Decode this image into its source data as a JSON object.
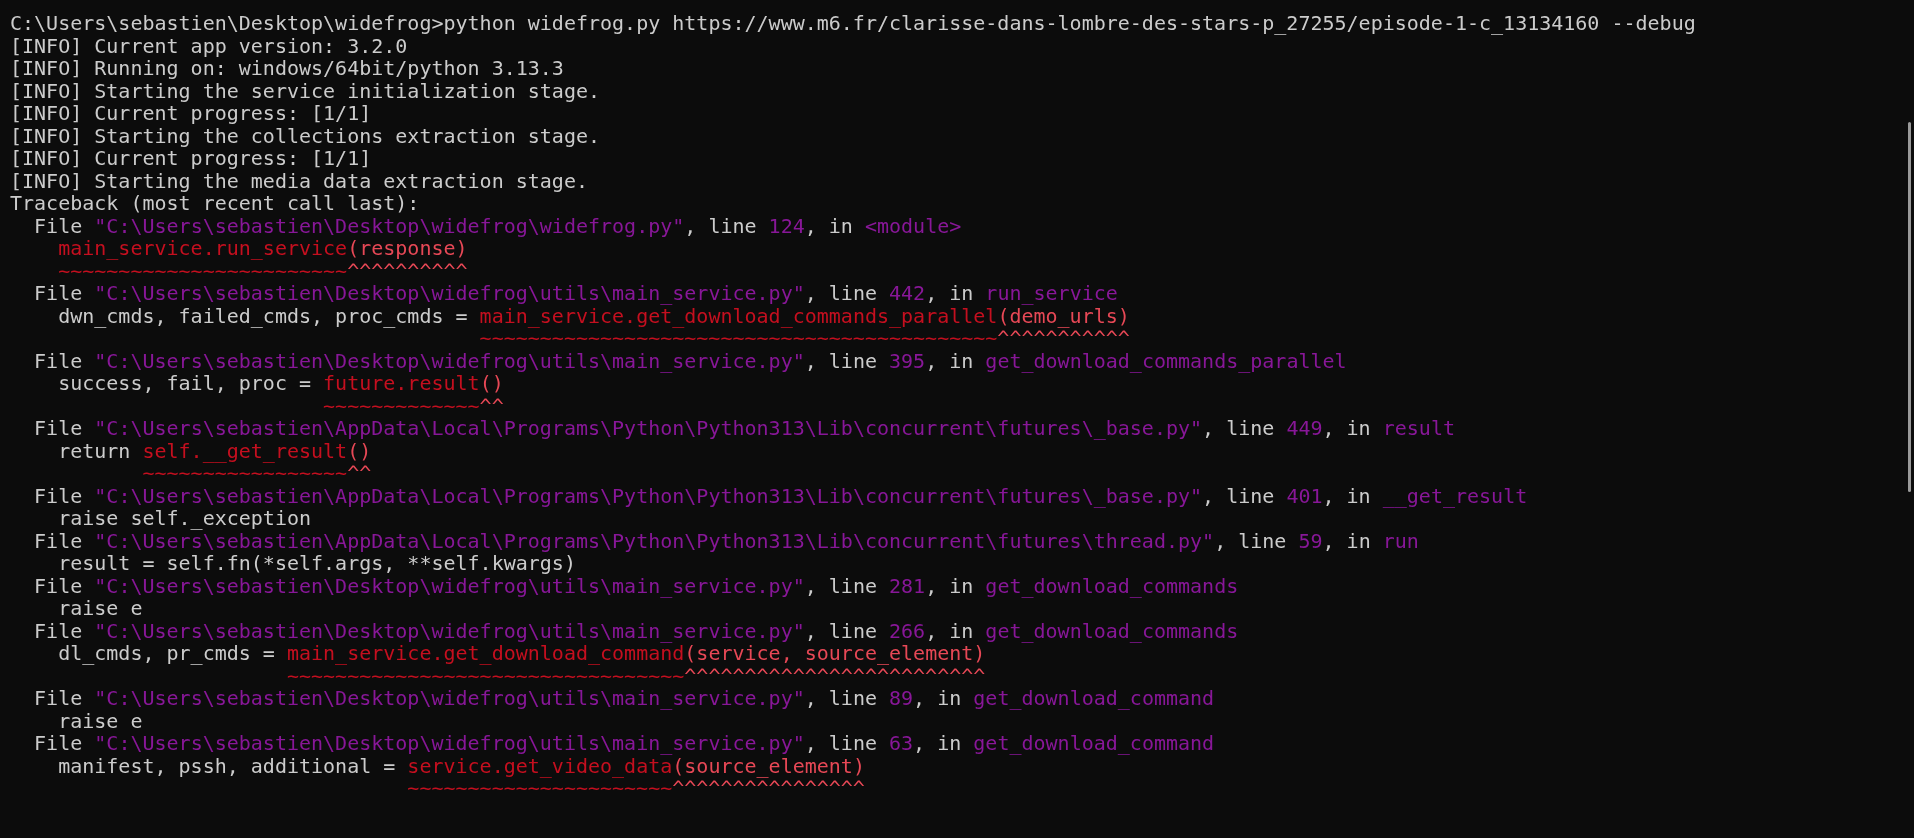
{
  "terminal": {
    "lines": [
      {
        "segments": [
          {
            "kind": "plain",
            "text": "C:\\Users\\sebastien\\Desktop\\widefrog>python widefrog.py https://www.m6.fr/clarisse-dans-lombre-des-stars-p_27255/episode-1-c_13134160 --debug"
          }
        ]
      },
      {
        "segments": [
          {
            "kind": "plain",
            "text": "[INFO] Current app version: 3.2.0"
          }
        ]
      },
      {
        "segments": [
          {
            "kind": "plain",
            "text": "[INFO] Running on: windows/64bit/python 3.13.3"
          }
        ]
      },
      {
        "segments": [
          {
            "kind": "plain",
            "text": "[INFO] Starting the service initialization stage."
          }
        ]
      },
      {
        "segments": [
          {
            "kind": "plain",
            "text": "[INFO] Current progress: [1/1]"
          }
        ]
      },
      {
        "segments": [
          {
            "kind": "plain",
            "text": "[INFO] Starting the collections extraction stage."
          }
        ]
      },
      {
        "segments": [
          {
            "kind": "plain",
            "text": "[INFO] Current progress: [1/1]"
          }
        ]
      },
      {
        "segments": [
          {
            "kind": "plain",
            "text": "[INFO] Starting the media data extraction stage."
          }
        ]
      },
      {
        "segments": [
          {
            "kind": "plain",
            "text": "Traceback (most recent call last):"
          }
        ]
      },
      {
        "segments": [
          {
            "kind": "plain",
            "text": "  File "
          },
          {
            "kind": "path",
            "text": "\"C:\\Users\\sebastien\\Desktop\\widefrog\\widefrog.py\""
          },
          {
            "kind": "plain",
            "text": ", line "
          },
          {
            "kind": "number",
            "text": "124"
          },
          {
            "kind": "plain",
            "text": ", in "
          },
          {
            "kind": "function",
            "text": "<module>"
          }
        ]
      },
      {
        "segments": [
          {
            "kind": "call",
            "text": "main_service.run_service"
          },
          {
            "kind": "args",
            "text": "(response)"
          }
        ]
      },
      {
        "segments": [
          {
            "kind": "tilde",
            "text": "~~~~~~~~~~~~~~~~~~~~~~~~"
          },
          {
            "kind": "caret",
            "text": "^^^^^^^^^^"
          }
        ]
      },
      {
        "segments": [
          {
            "kind": "plain",
            "text": "  File "
          },
          {
            "kind": "path",
            "text": "\"C:\\Users\\sebastien\\Desktop\\widefrog\\utils\\main_service.py\""
          },
          {
            "kind": "plain",
            "text": ", line "
          },
          {
            "kind": "number",
            "text": "442"
          },
          {
            "kind": "plain",
            "text": ", in "
          },
          {
            "kind": "function",
            "text": "run_service"
          }
        ]
      },
      {
        "segments": [
          {
            "kind": "plain",
            "text": "    dwn_cmds, failed_cmds, proc_cmds = "
          },
          {
            "kind": "call",
            "text": "main_service.get_download_commands_parallel"
          },
          {
            "kind": "args",
            "text": "(demo_urls)"
          }
        ]
      },
      {
        "segments": [
          {
            "kind": "tilde",
            "text": "~~~~~~~~~~~~~~~~~~~~~~~~~~~~~~~~~~~~~~~~~~~"
          },
          {
            "kind": "caret",
            "text": "^^^^^^^^^^^"
          }
        ]
      },
      {
        "segments": [
          {
            "kind": "plain",
            "text": "  File "
          },
          {
            "kind": "path",
            "text": "\"C:\\Users\\sebastien\\Desktop\\widefrog\\utils\\main_service.py\""
          },
          {
            "kind": "plain",
            "text": ", line "
          },
          {
            "kind": "number",
            "text": "395"
          },
          {
            "kind": "plain",
            "text": ", in "
          },
          {
            "kind": "function",
            "text": "get_download_commands_parallel"
          }
        ]
      },
      {
        "segments": [
          {
            "kind": "plain",
            "text": "    success, fail, proc = "
          },
          {
            "kind": "call",
            "text": "future.result"
          },
          {
            "kind": "args",
            "text": "()"
          }
        ]
      },
      {
        "segments": [
          {
            "kind": "tilde",
            "text": "~~~~~~~~~~~~~"
          },
          {
            "kind": "caret",
            "text": "^^"
          }
        ]
      },
      {
        "segments": [
          {
            "kind": "plain",
            "text": "  File "
          },
          {
            "kind": "path",
            "text": "\"C:\\Users\\sebastien\\AppData\\Local\\Programs\\Python\\Python313\\Lib\\concurrent\\futures\\_base.py\""
          },
          {
            "kind": "plain",
            "text": ", line "
          },
          {
            "kind": "number",
            "text": "449"
          },
          {
            "kind": "plain",
            "text": ", in "
          },
          {
            "kind": "function",
            "text": "result"
          }
        ]
      },
      {
        "segments": [
          {
            "kind": "plain",
            "text": "    return "
          },
          {
            "kind": "call",
            "text": "self.__get_result"
          },
          {
            "kind": "args",
            "text": "()"
          }
        ]
      },
      {
        "segments": [
          {
            "kind": "tilde",
            "text": "~~~~~~~~~~~~~~~~~"
          },
          {
            "kind": "caret",
            "text": "^^"
          }
        ]
      },
      {
        "segments": [
          {
            "kind": "plain",
            "text": "  File "
          },
          {
            "kind": "path",
            "text": "\"C:\\Users\\sebastien\\AppData\\Local\\Programs\\Python\\Python313\\Lib\\concurrent\\futures\\_base.py\""
          },
          {
            "kind": "plain",
            "text": ", line "
          },
          {
            "kind": "number",
            "text": "401"
          },
          {
            "kind": "plain",
            "text": ", in "
          },
          {
            "kind": "function",
            "text": "__get_result"
          }
        ]
      },
      {
        "segments": [
          {
            "kind": "plain",
            "text": "    raise self._exception"
          }
        ]
      },
      {
        "segments": [
          {
            "kind": "plain",
            "text": "  File "
          },
          {
            "kind": "path",
            "text": "\"C:\\Users\\sebastien\\AppData\\Local\\Programs\\Python\\Python313\\Lib\\concurrent\\futures\\thread.py\""
          },
          {
            "kind": "plain",
            "text": ", line "
          },
          {
            "kind": "number",
            "text": "59"
          },
          {
            "kind": "plain",
            "text": ", in "
          },
          {
            "kind": "function",
            "text": "run"
          }
        ]
      },
      {
        "segments": [
          {
            "kind": "plain",
            "text": "    result = self.fn(*self.args, **self.kwargs)"
          }
        ]
      },
      {
        "segments": [
          {
            "kind": "plain",
            "text": "  File "
          },
          {
            "kind": "path",
            "text": "\"C:\\Users\\sebastien\\Desktop\\widefrog\\utils\\main_service.py\""
          },
          {
            "kind": "plain",
            "text": ", line "
          },
          {
            "kind": "number",
            "text": "281"
          },
          {
            "kind": "plain",
            "text": ", in "
          },
          {
            "kind": "function",
            "text": "get_download_commands"
          }
        ]
      },
      {
        "segments": [
          {
            "kind": "plain",
            "text": "    raise e"
          }
        ]
      },
      {
        "segments": [
          {
            "kind": "plain",
            "text": "  File "
          },
          {
            "kind": "path",
            "text": "\"C:\\Users\\sebastien\\Desktop\\widefrog\\utils\\main_service.py\""
          },
          {
            "kind": "plain",
            "text": ", line "
          },
          {
            "kind": "number",
            "text": "266"
          },
          {
            "kind": "plain",
            "text": ", in "
          },
          {
            "kind": "function",
            "text": "get_download_commands"
          }
        ]
      },
      {
        "segments": [
          {
            "kind": "plain",
            "text": "    dl_cmds, pr_cmds = "
          },
          {
            "kind": "call",
            "text": "main_service.get_download_command"
          },
          {
            "kind": "args",
            "text": "(service, source_element)"
          }
        ]
      },
      {
        "segments": [
          {
            "kind": "tilde",
            "text": "~~~~~~~~~~~~~~~~~~~~~~~~~~~~~~~~~"
          },
          {
            "kind": "caret",
            "text": "^^^^^^^^^^^^^^^^^^^^^^^^^"
          }
        ]
      },
      {
        "segments": [
          {
            "kind": "plain",
            "text": "  File "
          },
          {
            "kind": "path",
            "text": "\"C:\\Users\\sebastien\\Desktop\\widefrog\\utils\\main_service.py\""
          },
          {
            "kind": "plain",
            "text": ", line "
          },
          {
            "kind": "number",
            "text": "89"
          },
          {
            "kind": "plain",
            "text": ", in "
          },
          {
            "kind": "function",
            "text": "get_download_command"
          }
        ]
      },
      {
        "segments": [
          {
            "kind": "plain",
            "text": "    raise e"
          }
        ]
      },
      {
        "segments": [
          {
            "kind": "plain",
            "text": "  File "
          },
          {
            "kind": "path",
            "text": "\"C:\\Users\\sebastien\\Desktop\\widefrog\\utils\\main_service.py\""
          },
          {
            "kind": "plain",
            "text": ", line "
          },
          {
            "kind": "number",
            "text": "63"
          },
          {
            "kind": "plain",
            "text": ", in "
          },
          {
            "kind": "function",
            "text": "get_download_command"
          }
        ]
      },
      {
        "segments": [
          {
            "kind": "plain",
            "text": "    manifest, pssh, additional = "
          },
          {
            "kind": "call",
            "text": "service.get_video_data"
          },
          {
            "kind": "args",
            "text": "(source_element)"
          }
        ]
      },
      {
        "segments": [
          {
            "kind": "tilde",
            "text": "~~~~~~~~~~~~~~~~~~~~~~"
          },
          {
            "kind": "caret",
            "text": "^^^^^^^^^^^^^^^^"
          }
        ]
      }
    ]
  }
}
